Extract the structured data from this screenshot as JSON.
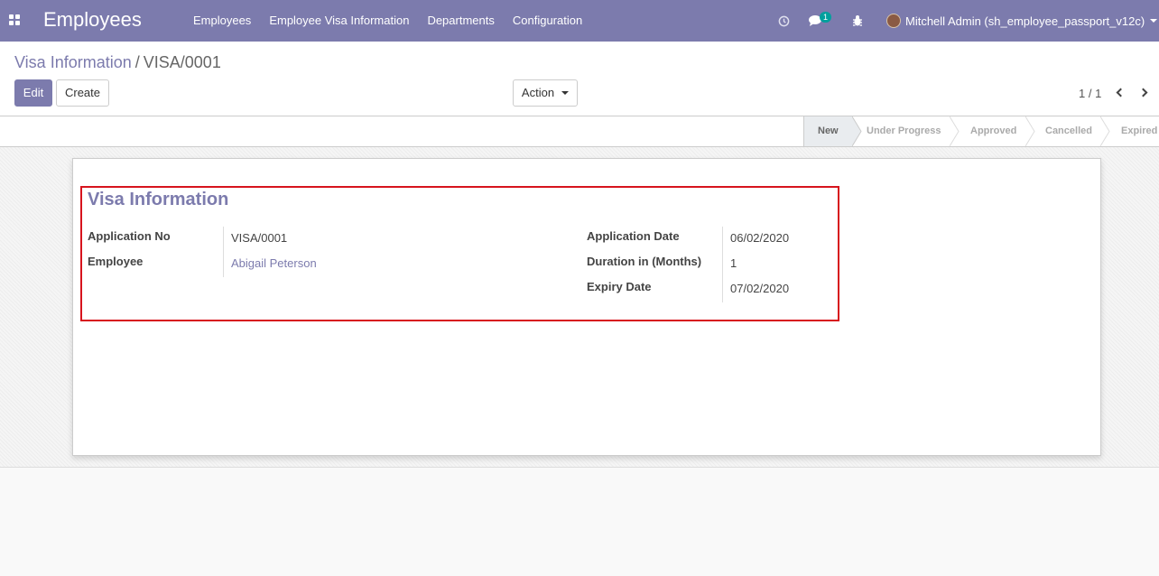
{
  "navbar": {
    "app_title": "Employees",
    "menu": [
      "Employees",
      "Employee Visa Information",
      "Departments",
      "Configuration"
    ],
    "chat_badge": "1",
    "user": "Mitchell Admin (sh_employee_passport_v12c)",
    "icons": [
      "apps-icon",
      "clock-icon",
      "chat-icon",
      "bug-icon",
      "avatar",
      "caret-down-icon"
    ]
  },
  "breadcrumb": {
    "parent": "Visa Information",
    "separator": "/",
    "current": "VISA/0001"
  },
  "buttons": {
    "edit": "Edit",
    "create": "Create",
    "action": "Action"
  },
  "pager": {
    "value": "1 / 1"
  },
  "statusbar": {
    "stages": [
      "New",
      "Under Progress",
      "Approved",
      "Cancelled",
      "Expired"
    ],
    "active": "New"
  },
  "form": {
    "title": "Visa Information",
    "left": [
      {
        "label": "Application No",
        "value": "VISA/0001"
      },
      {
        "label": "Employee",
        "value": "Abigail Peterson"
      }
    ],
    "right": [
      {
        "label": "Application Date",
        "value": "06/02/2020"
      },
      {
        "label": "Duration in (Months)",
        "value": "1"
      },
      {
        "label": "Expiry Date",
        "value": "07/02/2020"
      }
    ]
  },
  "colors": {
    "brand": "#7c7bad",
    "highlight_border": "#d7141d",
    "badge": "#00a09d"
  }
}
